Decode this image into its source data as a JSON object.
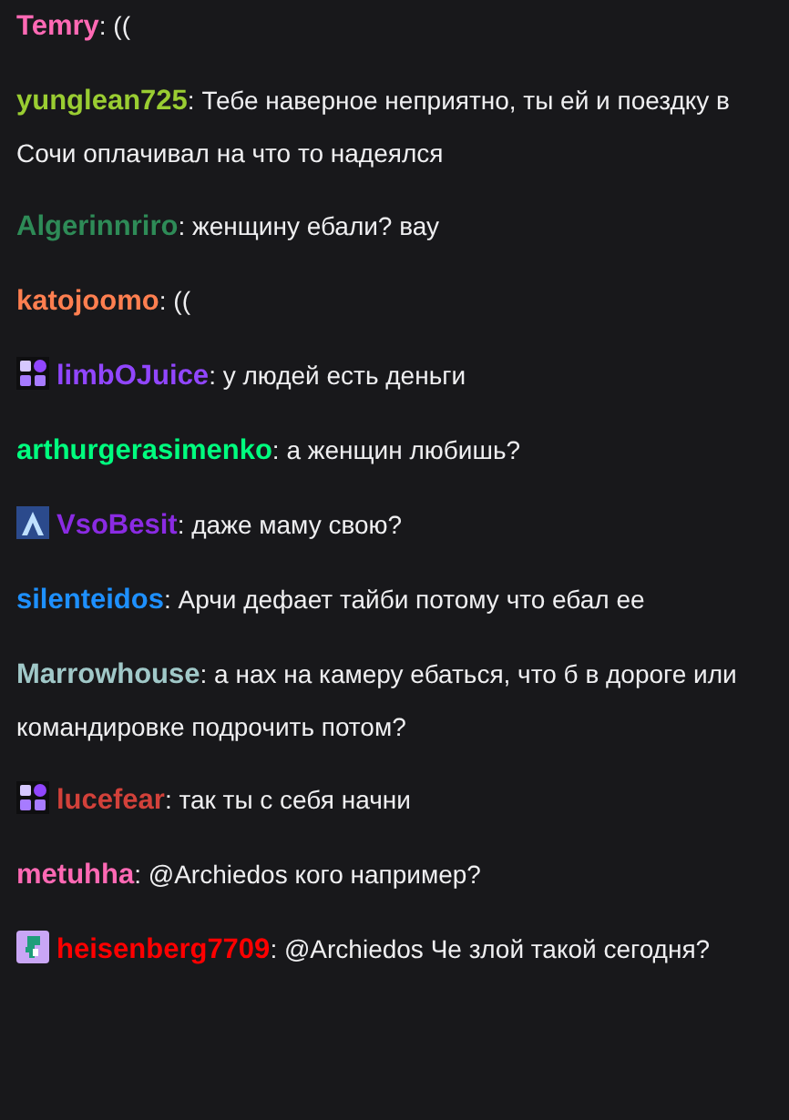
{
  "messages": [
    {
      "kind": "plain",
      "user": "Temry",
      "color": "#ff69b4",
      "separator": ":",
      "text": "(("
    },
    {
      "kind": "plain",
      "user": "yunglean725",
      "color": "#9acd32",
      "separator": ":",
      "text": "Тебе наверное неприятно, ты ей и поездку в Сочи оплачивал на что то надеялся"
    },
    {
      "kind": "plain",
      "user": "Algerinnriro",
      "color": "#2e8b57",
      "separator": ":",
      "text": "женщину ебали? вау"
    },
    {
      "kind": "plain",
      "user": "katojoomo",
      "color": "#ff7f50",
      "separator": ":",
      "text": "(("
    },
    {
      "kind": "year",
      "user": "limbOJuice",
      "color": "#9146ff",
      "separator": ":",
      "text": "у людей есть деньги"
    },
    {
      "kind": "plain",
      "user": "arthurgerasimenko",
      "color": "#00ff7f",
      "separator": ":",
      "text": "а женщин любишь?"
    },
    {
      "kind": "arrow",
      "user": "VsoBesit",
      "color": "#8a2be2",
      "separator": ":",
      "text": "даже маму свою?"
    },
    {
      "kind": "plain",
      "user": "silenteidos",
      "color": "#1e90ff",
      "separator": ":",
      "text": "Арчи дефает тайби потому что ебал ее"
    },
    {
      "kind": "plain",
      "user": "Marrowhouse",
      "color": "#a0c8c8",
      "separator": ":",
      "text": "а нах на камеру ебаться, что б в дороге или командировке подрочить потом?"
    },
    {
      "kind": "year",
      "user": "lucefear",
      "color": "#d2413a",
      "separator": ":",
      "text": "так ты с себя начни"
    },
    {
      "kind": "plain",
      "user": "metuhha",
      "color": "#ff69b4",
      "separator": ":",
      "text": "@Archiedos кого например?"
    },
    {
      "kind": "dino",
      "user": "heisenberg7709",
      "color": "#ff0000",
      "separator": ":",
      "text": "@Archiedos Че злой такой сегодня?"
    }
  ]
}
